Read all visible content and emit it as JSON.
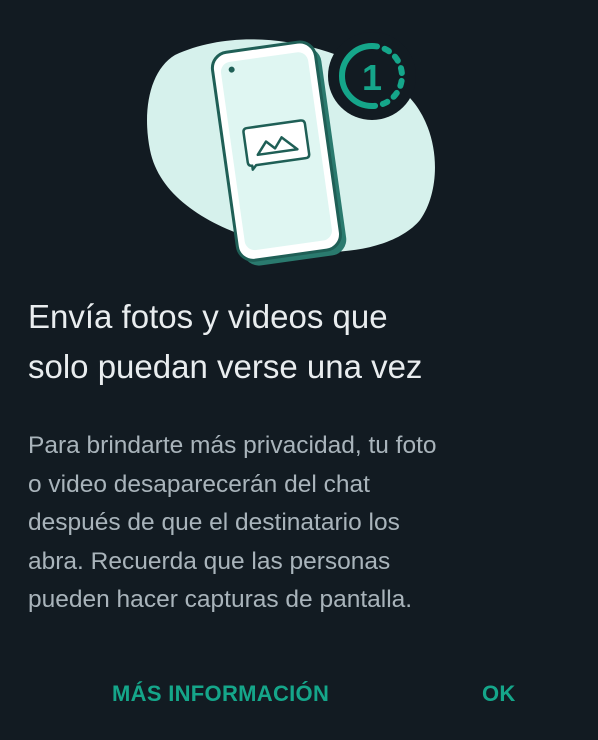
{
  "dialog": {
    "title_line1": "Envía fotos y videos que",
    "title_line2": "solo puedan verse una vez",
    "body_lines": [
      "Para brindarte más privacidad, tu foto",
      "o video desaparecerán del chat",
      "después de que el destinatario los",
      "abra. Recuerda que las personas",
      "pueden hacer capturas de pantalla."
    ]
  },
  "illustration": {
    "view_once_number": "1",
    "icons": [
      "phone-icon",
      "image-message-icon",
      "view-once-icon"
    ]
  },
  "actions": {
    "more_info_label": "MÁS INFORMACIÓN",
    "ok_label": "OK"
  },
  "colors": {
    "background": "#121b22",
    "accent": "#15a68a",
    "title": "#e9edef",
    "body": "#a9b4bb",
    "illustration_blob": "#d6f1ec"
  }
}
